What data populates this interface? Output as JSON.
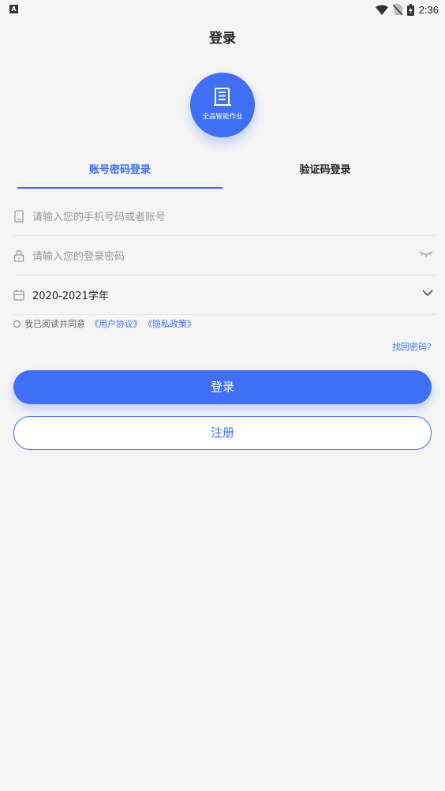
{
  "status_bar": {
    "left_icon": "A",
    "time": "2:36",
    "icons": [
      "wifi-icon",
      "no-sim-icon",
      "battery-icon"
    ]
  },
  "header": {
    "title": "登录"
  },
  "logo": {
    "text": "全品智能作业"
  },
  "tabs": [
    {
      "label": "账号密码登录",
      "active": true
    },
    {
      "label": "验证码登录",
      "active": false
    }
  ],
  "form": {
    "account_placeholder": "请输入您的手机号码或者账号",
    "password_placeholder": "请输入您的登录密码",
    "school_year": "2020-2021学年"
  },
  "agreement": {
    "prefix": "我已阅读并同意",
    "user_agreement": "《用户协议》",
    "privacy_policy": "《隐私政策》"
  },
  "forgot_password": "找回密码?",
  "buttons": {
    "login": "登录",
    "register": "注册"
  },
  "colors": {
    "accent": "#3f6ff5",
    "background": "#f5f5f5"
  }
}
